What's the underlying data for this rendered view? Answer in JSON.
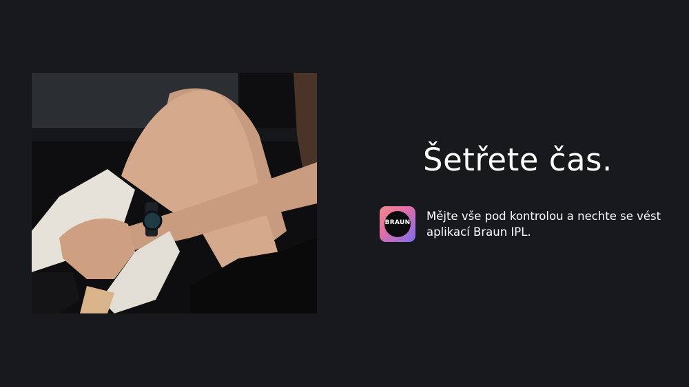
{
  "hero": {
    "title": "Šetřete čas.",
    "description": "Mějte vše pod kontrolou a nechte se vést aplikací Braun IPL."
  },
  "app_icon": {
    "brand_text": "BRAUN",
    "icon": "braun-app-icon",
    "gradient_colors": [
      "#f08a8d",
      "#e46fa4",
      "#7b6cf0"
    ]
  },
  "photo": {
    "icon": "lifestyle-photo"
  },
  "colors": {
    "background": "#18191d",
    "text": "#ffffff"
  }
}
